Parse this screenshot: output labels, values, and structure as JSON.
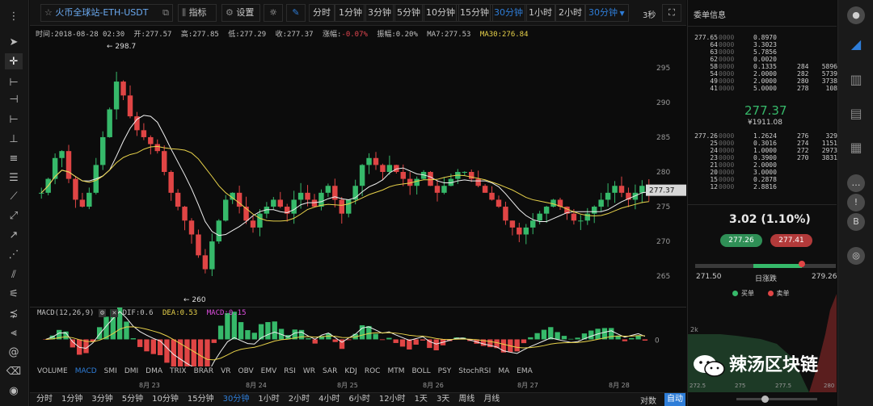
{
  "toolbar": {
    "pair": "火币全球站-ETH-USDT",
    "indicators_label": "指标",
    "settings_label": "设置",
    "periods": [
      "分时",
      "1分钟",
      "3分钟",
      "5分钟",
      "10分钟",
      "15分钟",
      "30分钟",
      "1小时",
      "2小时"
    ],
    "selected_period": "30分钟",
    "period_dropdown": "30分钟",
    "refresh": "3秒"
  },
  "info": {
    "time_label": "时间:",
    "time": "2018-08-28 02:30",
    "open_label": "开:",
    "open": "277.57",
    "high_label": "高:",
    "high": "277.85",
    "low_label": "低:",
    "low": "277.29",
    "close_label": "收:",
    "close": "277.37",
    "change_label": "涨幅:",
    "change": "-0.07%",
    "amplitude_label": "振幅:",
    "amplitude": "0.20%",
    "ma7_label": "MA7:",
    "ma7": "277.53",
    "ma30_label": "MA30:",
    "ma30": "276.84"
  },
  "chart_data": {
    "type": "candlestick",
    "y_axis_ticks": [
      "295",
      "290",
      "285",
      "280",
      "275",
      "270",
      "265"
    ],
    "ylim": [
      262,
      298
    ],
    "x_axis_ticks": [
      "8月 23",
      "8月 24",
      "8月 25",
      "8月 26",
      "8月 27",
      "8月 28"
    ],
    "high_annotation": "298.7",
    "low_annotation": "260",
    "current_price_tag": "277.37",
    "close_series": [
      277,
      279,
      282,
      283,
      279,
      276,
      275,
      277,
      281,
      285,
      289,
      293,
      291,
      288,
      286,
      285,
      284,
      283,
      280,
      277,
      275,
      273,
      271,
      268,
      266,
      270,
      273,
      276,
      277,
      275,
      273,
      272,
      274,
      275,
      276,
      275,
      274,
      276,
      277,
      276,
      275,
      277,
      278,
      276,
      274,
      276,
      278,
      281,
      282,
      281,
      280,
      281,
      280,
      279,
      278,
      279,
      280,
      278,
      277,
      278,
      279,
      280,
      280,
      279,
      278,
      277,
      276,
      275,
      273,
      272,
      271,
      272,
      273,
      274,
      275,
      276,
      275,
      274,
      273,
      273,
      274,
      275,
      276,
      277,
      278,
      277,
      276,
      277,
      278,
      277
    ]
  },
  "macd": {
    "title": "MACD(12,26,9)",
    "dif_label": "DIF:",
    "dif": "0.6",
    "dea_label": "DEA:",
    "dea": "0.53",
    "macd_label": "MACD:",
    "macd": "0.15",
    "zero_label": "0"
  },
  "indicator_tabs": [
    "VOLUME",
    "MACD",
    "SMI",
    "DMI",
    "DMA",
    "TRIX",
    "BRAR",
    "VR",
    "OBV",
    "EMV",
    "RSI",
    "WR",
    "SAR",
    "KDJ",
    "ROC",
    "MTM",
    "BOLL",
    "PSY",
    "StochRSI",
    "MA",
    "EMA"
  ],
  "selected_indicator": "MACD",
  "bottom_periods": [
    "分时",
    "1分钟",
    "3分钟",
    "5分钟",
    "10分钟",
    "15分钟",
    "30分钟",
    "1小时",
    "2小时",
    "4小时",
    "6小时",
    "12小时",
    "1天",
    "3天",
    "周线",
    "月线"
  ],
  "bottom_selected": "30分钟",
  "bottom_right": [
    "对数",
    "自动"
  ],
  "orderbook": {
    "title": "委单信息",
    "asks": [
      {
        "price": "277.65",
        "price_tail": "0000",
        "amount": "0.8970",
        "count": "",
        "total": ""
      },
      {
        "price": "64",
        "price_tail": "0000",
        "amount": "3.3023",
        "count": "",
        "total": ""
      },
      {
        "price": "63",
        "price_tail": "0000",
        "amount": "5.7856",
        "count": "",
        "total": ""
      },
      {
        "price": "62",
        "price_tail": "0000",
        "amount": "0.0020",
        "count": "",
        "total": ""
      },
      {
        "price": "58",
        "price_tail": "0000",
        "amount": "0.1335",
        "count": "284",
        "total": "5896"
      },
      {
        "price": "54",
        "price_tail": "0000",
        "amount": "2.0000",
        "count": "282",
        "total": "5739"
      },
      {
        "price": "49",
        "price_tail": "0000",
        "amount": "2.0000",
        "count": "280",
        "total": "3738"
      },
      {
        "price": "41",
        "price_tail": "0000",
        "amount": "5.0000",
        "count": "278",
        "total": "108"
      }
    ],
    "last_price": "277.37",
    "last_price_cny": "¥1911.08",
    "bids": [
      {
        "price": "277.26",
        "price_tail": "0000",
        "amount": "1.2624",
        "count": "276",
        "total": "329"
      },
      {
        "price": "25",
        "price_tail": "0000",
        "amount": "0.3016",
        "count": "274",
        "total": "1151"
      },
      {
        "price": "24",
        "price_tail": "0000",
        "amount": "1.0000",
        "count": "272",
        "total": "2973"
      },
      {
        "price": "23",
        "price_tail": "0000",
        "amount": "0.3900",
        "count": "270",
        "total": "3831"
      },
      {
        "price": "21",
        "price_tail": "0000",
        "amount": "2.0000",
        "count": "",
        "total": ""
      },
      {
        "price": "20",
        "price_tail": "0000",
        "amount": "3.0000",
        "count": "",
        "total": ""
      },
      {
        "price": "15",
        "price_tail": "0000",
        "amount": "0.2878",
        "count": "",
        "total": ""
      },
      {
        "price": "12",
        "price_tail": "0000",
        "amount": "2.8816",
        "count": "",
        "total": ""
      }
    ],
    "change": "3.02 (1.10%)",
    "bid_button": "277.26",
    "ask_button": "277.41",
    "range_low": "271.50",
    "range_label": "日涨跌",
    "range_high": "279.26",
    "legend_buy": "买单",
    "legend_sell": "卖单",
    "depth_axis_label": "2k",
    "depth_x_ticks": [
      "272.5",
      "275",
      "277.5",
      "280"
    ],
    "colors": {
      "buy": "#36b96a",
      "sell": "#e04545"
    }
  },
  "watermark": "辣汤区块链"
}
